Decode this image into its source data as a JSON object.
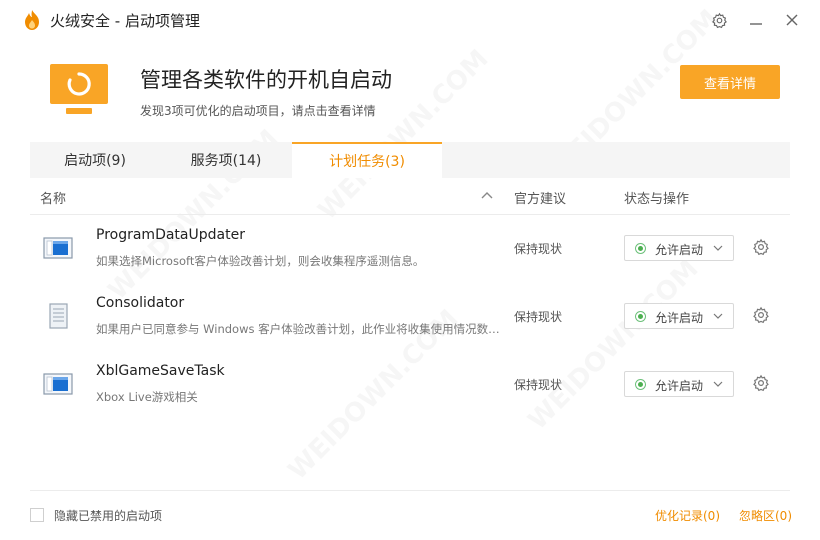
{
  "window": {
    "title": "火绒安全 - 启动项管理",
    "brand_color": "#f9a526"
  },
  "header": {
    "title": "管理各类软件的开机自启动",
    "subtitle": "发现3项可优化的启动项目，请点击查看详情",
    "detail_button": "查看详情",
    "icon": "monitor-icon"
  },
  "tabs": [
    {
      "label": "启动项(9)",
      "active": false
    },
    {
      "label": "服务项(14)",
      "active": false
    },
    {
      "label": "计划任务(3)",
      "active": true
    }
  ],
  "columns": {
    "name": "名称",
    "advice": "官方建议",
    "status": "状态与操作"
  },
  "rows": [
    {
      "title": "ProgramDataUpdater",
      "desc": "如果选择Microsoft客户体验改善计划，则会收集程序遥测信息。",
      "advice": "保持现状",
      "status": "允许启动",
      "icon": "window-app-icon"
    },
    {
      "title": "Consolidator",
      "desc": "如果用户已同意参与 Windows 客户体验改善计划，此作业将收集使用情况数据并发送到 Microsoft。",
      "advice": "保持现状",
      "status": "允许启动",
      "icon": "document-icon"
    },
    {
      "title": "XblGameSaveTask",
      "desc": "Xbox Live游戏相关",
      "advice": "保持现状",
      "status": "允许启动",
      "icon": "window-app-icon"
    }
  ],
  "footer": {
    "hide_disabled": "隐藏已禁用的启动项",
    "optimize_record": "优化记录(0)",
    "ignore_zone": "忽略区(0)"
  }
}
